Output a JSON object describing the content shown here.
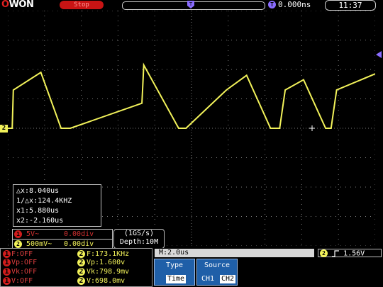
{
  "header": {
    "logo_prefix": "O",
    "logo_suffix": "WON",
    "run_status": "Stop",
    "trigger_position": "0.000ns",
    "clock": "11:37"
  },
  "markers": {
    "ch2_ground": "2",
    "top_trigger": "T",
    "time_position_icon": "T"
  },
  "cursor": {
    "delta_x": "△x:8.040us",
    "inv_delta_x": "1/△x:124.4KHZ",
    "x1": "x1:5.880us",
    "x2": "x2:-2.160us"
  },
  "channels": {
    "ch1": {
      "icon": "1",
      "volts": "5V~",
      "offset": "0.00div",
      "color": "#d03030"
    },
    "ch2": {
      "icon": "2",
      "volts": "500mV~",
      "offset": "0.00div",
      "color": "#f2f25a"
    }
  },
  "acquisition": {
    "sample_rate": "(1GS/s)",
    "depth": "Depth:10M"
  },
  "measurements": {
    "ch1": [
      "F:OFF",
      "Vp:OFF",
      "Vk:OFF",
      "V:OFF"
    ],
    "ch2": [
      "F:173.1KHz",
      "Vp:1.600v",
      "Vk:798.9mv",
      "V:698.0mv"
    ],
    "ch1_icon": "1",
    "ch2_icon": "2"
  },
  "timebase": "M:2.0us",
  "trigger": {
    "channel": "2",
    "level": "1.56V",
    "slope_icon": "rising-edge-icon"
  },
  "menu": {
    "type": {
      "title": "Type",
      "options": [
        "Time"
      ],
      "selected": "Time"
    },
    "source": {
      "title": "Source",
      "options": [
        "CH1",
        "CH2"
      ],
      "selected": "CH2"
    }
  },
  "colors": {
    "ch1": "#d03030",
    "ch2": "#f2f25a",
    "menu_bg": "#1f5fa8",
    "status_red": "#c81414"
  },
  "waveform": {
    "channel": "CH2",
    "baseline_div": 0.0,
    "description_points_div": [
      [
        -5.0,
        0.0
      ],
      [
        -4.88,
        0.0
      ],
      [
        -4.85,
        1.3
      ],
      [
        -4.1,
        1.9
      ],
      [
        -3.55,
        0.0
      ],
      [
        -3.3,
        0.0
      ],
      [
        -1.35,
        0.85
      ],
      [
        -1.3,
        2.15
      ],
      [
        -0.35,
        0.0
      ],
      [
        -0.15,
        0.0
      ],
      [
        0.95,
        1.3
      ],
      [
        1.5,
        1.8
      ],
      [
        2.15,
        0.0
      ],
      [
        2.4,
        0.0
      ],
      [
        2.55,
        1.3
      ],
      [
        3.05,
        1.65
      ],
      [
        3.65,
        0.0
      ],
      [
        3.8,
        0.0
      ],
      [
        3.95,
        1.3
      ],
      [
        5.0,
        1.85
      ]
    ]
  }
}
